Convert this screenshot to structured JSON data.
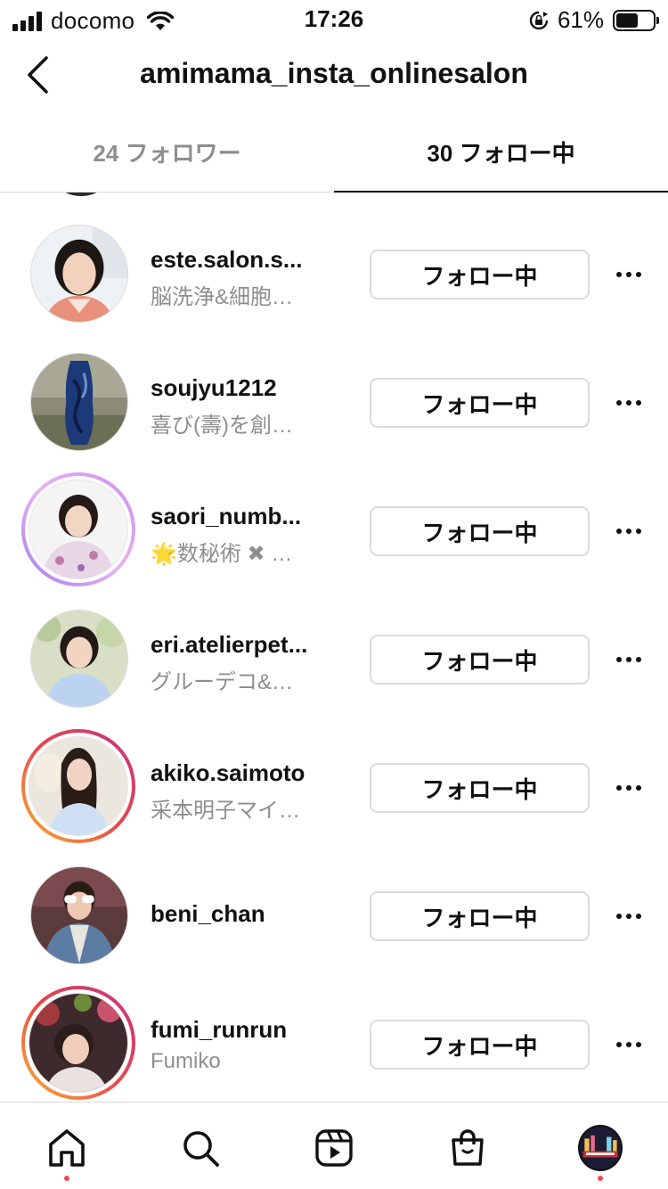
{
  "status_bar": {
    "carrier": "docomo",
    "time": "17:26",
    "battery_percent": "61%",
    "battery_level": 0.61
  },
  "header": {
    "title": "amimama_insta_onlinesalon",
    "back_icon": "chevron-left-icon"
  },
  "tabs": [
    {
      "label": "24 フォロワー",
      "active": false
    },
    {
      "label": "30 フォロー中",
      "active": true
    }
  ],
  "rows": [
    {
      "username": "este.salon.s...",
      "subname": "脳洗浄&細胞…",
      "button": "フォロー中",
      "ring": "none"
    },
    {
      "username": "soujyu1212",
      "subname": "喜び(壽)を創…",
      "button": "フォロー中",
      "ring": "none"
    },
    {
      "username": "saori_numb...",
      "subname": "🌟数秘術 ✖ …",
      "button": "フォロー中",
      "ring": "close-friends"
    },
    {
      "username": "eri.atelierpet...",
      "subname": "グルーデコ&…",
      "button": "フォロー中",
      "ring": "none"
    },
    {
      "username": "akiko.saimoto",
      "subname": "采本明子マイ…",
      "button": "フォロー中",
      "ring": "story"
    },
    {
      "username": "beni_chan",
      "subname": "",
      "button": "フォロー中",
      "ring": "none"
    },
    {
      "username": "fumi_runrun",
      "subname": "Fumiko",
      "button": "フォロー中",
      "ring": "story"
    }
  ],
  "bottom_nav": [
    {
      "icon": "home-icon",
      "notification_dot": true
    },
    {
      "icon": "search-icon",
      "notification_dot": false
    },
    {
      "icon": "reels-icon",
      "notification_dot": false
    },
    {
      "icon": "shop-icon",
      "notification_dot": false
    },
    {
      "icon": "profile-avatar",
      "notification_dot": true
    }
  ],
  "colors": {
    "secondary_text": "#8e8e8e",
    "border": "#dbdbdb",
    "notification_dot": "#ed4956"
  }
}
